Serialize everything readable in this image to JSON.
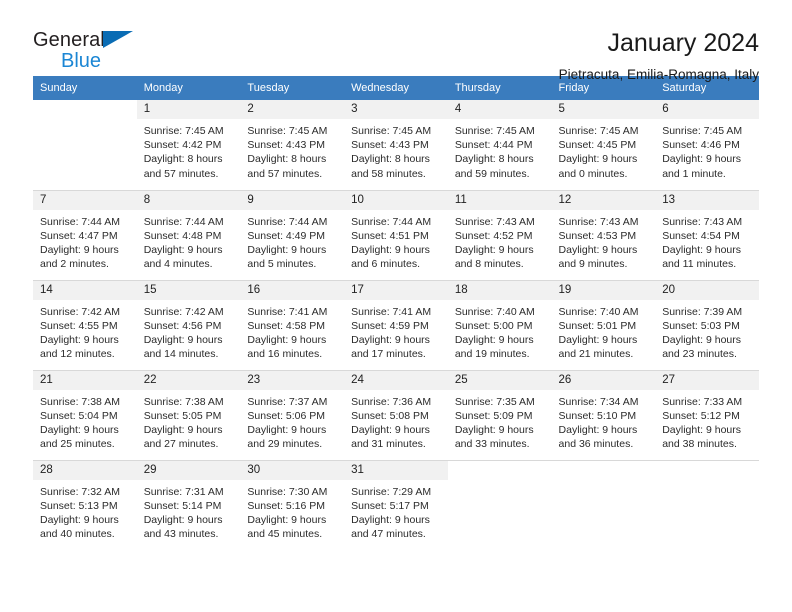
{
  "brand": {
    "name_top": "General",
    "name_bottom": "Blue",
    "accent_color": "#0a6cb4",
    "accent_color_light": "#1b86d4"
  },
  "header": {
    "title": "January 2024",
    "subtitle": "Pietracuta, Emilia-Romagna, Italy"
  },
  "calendar": {
    "header_bg": "#3a7cbe",
    "daynum_bg": "#f1f1f1",
    "weekdays": [
      "Sunday",
      "Monday",
      "Tuesday",
      "Wednesday",
      "Thursday",
      "Friday",
      "Saturday"
    ],
    "weeks": [
      [
        {
          "day": "",
          "lines": []
        },
        {
          "day": "1",
          "lines": [
            "Sunrise: 7:45 AM",
            "Sunset: 4:42 PM",
            "Daylight: 8 hours",
            "and 57 minutes."
          ]
        },
        {
          "day": "2",
          "lines": [
            "Sunrise: 7:45 AM",
            "Sunset: 4:43 PM",
            "Daylight: 8 hours",
            "and 57 minutes."
          ]
        },
        {
          "day": "3",
          "lines": [
            "Sunrise: 7:45 AM",
            "Sunset: 4:43 PM",
            "Daylight: 8 hours",
            "and 58 minutes."
          ]
        },
        {
          "day": "4",
          "lines": [
            "Sunrise: 7:45 AM",
            "Sunset: 4:44 PM",
            "Daylight: 8 hours",
            "and 59 minutes."
          ]
        },
        {
          "day": "5",
          "lines": [
            "Sunrise: 7:45 AM",
            "Sunset: 4:45 PM",
            "Daylight: 9 hours",
            "and 0 minutes."
          ]
        },
        {
          "day": "6",
          "lines": [
            "Sunrise: 7:45 AM",
            "Sunset: 4:46 PM",
            "Daylight: 9 hours",
            "and 1 minute."
          ]
        }
      ],
      [
        {
          "day": "7",
          "lines": [
            "Sunrise: 7:44 AM",
            "Sunset: 4:47 PM",
            "Daylight: 9 hours",
            "and 2 minutes."
          ]
        },
        {
          "day": "8",
          "lines": [
            "Sunrise: 7:44 AM",
            "Sunset: 4:48 PM",
            "Daylight: 9 hours",
            "and 4 minutes."
          ]
        },
        {
          "day": "9",
          "lines": [
            "Sunrise: 7:44 AM",
            "Sunset: 4:49 PM",
            "Daylight: 9 hours",
            "and 5 minutes."
          ]
        },
        {
          "day": "10",
          "lines": [
            "Sunrise: 7:44 AM",
            "Sunset: 4:51 PM",
            "Daylight: 9 hours",
            "and 6 minutes."
          ]
        },
        {
          "day": "11",
          "lines": [
            "Sunrise: 7:43 AM",
            "Sunset: 4:52 PM",
            "Daylight: 9 hours",
            "and 8 minutes."
          ]
        },
        {
          "day": "12",
          "lines": [
            "Sunrise: 7:43 AM",
            "Sunset: 4:53 PM",
            "Daylight: 9 hours",
            "and 9 minutes."
          ]
        },
        {
          "day": "13",
          "lines": [
            "Sunrise: 7:43 AM",
            "Sunset: 4:54 PM",
            "Daylight: 9 hours",
            "and 11 minutes."
          ]
        }
      ],
      [
        {
          "day": "14",
          "lines": [
            "Sunrise: 7:42 AM",
            "Sunset: 4:55 PM",
            "Daylight: 9 hours",
            "and 12 minutes."
          ]
        },
        {
          "day": "15",
          "lines": [
            "Sunrise: 7:42 AM",
            "Sunset: 4:56 PM",
            "Daylight: 9 hours",
            "and 14 minutes."
          ]
        },
        {
          "day": "16",
          "lines": [
            "Sunrise: 7:41 AM",
            "Sunset: 4:58 PM",
            "Daylight: 9 hours",
            "and 16 minutes."
          ]
        },
        {
          "day": "17",
          "lines": [
            "Sunrise: 7:41 AM",
            "Sunset: 4:59 PM",
            "Daylight: 9 hours",
            "and 17 minutes."
          ]
        },
        {
          "day": "18",
          "lines": [
            "Sunrise: 7:40 AM",
            "Sunset: 5:00 PM",
            "Daylight: 9 hours",
            "and 19 minutes."
          ]
        },
        {
          "day": "19",
          "lines": [
            "Sunrise: 7:40 AM",
            "Sunset: 5:01 PM",
            "Daylight: 9 hours",
            "and 21 minutes."
          ]
        },
        {
          "day": "20",
          "lines": [
            "Sunrise: 7:39 AM",
            "Sunset: 5:03 PM",
            "Daylight: 9 hours",
            "and 23 minutes."
          ]
        }
      ],
      [
        {
          "day": "21",
          "lines": [
            "Sunrise: 7:38 AM",
            "Sunset: 5:04 PM",
            "Daylight: 9 hours",
            "and 25 minutes."
          ]
        },
        {
          "day": "22",
          "lines": [
            "Sunrise: 7:38 AM",
            "Sunset: 5:05 PM",
            "Daylight: 9 hours",
            "and 27 minutes."
          ]
        },
        {
          "day": "23",
          "lines": [
            "Sunrise: 7:37 AM",
            "Sunset: 5:06 PM",
            "Daylight: 9 hours",
            "and 29 minutes."
          ]
        },
        {
          "day": "24",
          "lines": [
            "Sunrise: 7:36 AM",
            "Sunset: 5:08 PM",
            "Daylight: 9 hours",
            "and 31 minutes."
          ]
        },
        {
          "day": "25",
          "lines": [
            "Sunrise: 7:35 AM",
            "Sunset: 5:09 PM",
            "Daylight: 9 hours",
            "and 33 minutes."
          ]
        },
        {
          "day": "26",
          "lines": [
            "Sunrise: 7:34 AM",
            "Sunset: 5:10 PM",
            "Daylight: 9 hours",
            "and 36 minutes."
          ]
        },
        {
          "day": "27",
          "lines": [
            "Sunrise: 7:33 AM",
            "Sunset: 5:12 PM",
            "Daylight: 9 hours",
            "and 38 minutes."
          ]
        }
      ],
      [
        {
          "day": "28",
          "lines": [
            "Sunrise: 7:32 AM",
            "Sunset: 5:13 PM",
            "Daylight: 9 hours",
            "and 40 minutes."
          ]
        },
        {
          "day": "29",
          "lines": [
            "Sunrise: 7:31 AM",
            "Sunset: 5:14 PM",
            "Daylight: 9 hours",
            "and 43 minutes."
          ]
        },
        {
          "day": "30",
          "lines": [
            "Sunrise: 7:30 AM",
            "Sunset: 5:16 PM",
            "Daylight: 9 hours",
            "and 45 minutes."
          ]
        },
        {
          "day": "31",
          "lines": [
            "Sunrise: 7:29 AM",
            "Sunset: 5:17 PM",
            "Daylight: 9 hours",
            "and 47 minutes."
          ]
        },
        {
          "day": "",
          "lines": []
        },
        {
          "day": "",
          "lines": []
        },
        {
          "day": "",
          "lines": []
        }
      ]
    ]
  }
}
